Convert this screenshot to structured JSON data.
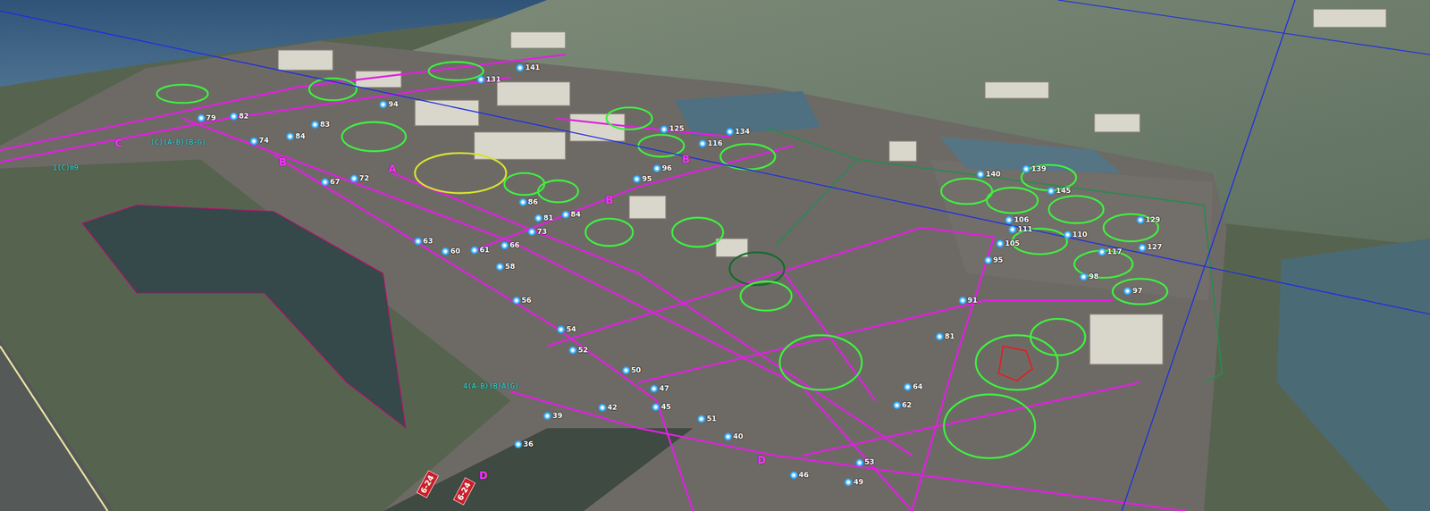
{
  "viewport": {
    "markers": [
      {
        "label": "79"
      },
      {
        "label": "82"
      },
      {
        "label": "74"
      },
      {
        "label": "84"
      },
      {
        "label": "83"
      },
      {
        "label": "94"
      },
      {
        "label": "131"
      },
      {
        "label": "141"
      },
      {
        "label": "125"
      },
      {
        "label": "134"
      },
      {
        "label": "116"
      },
      {
        "label": "96"
      },
      {
        "label": "95"
      },
      {
        "label": "86"
      },
      {
        "label": "84"
      },
      {
        "label": "81"
      },
      {
        "label": "72"
      },
      {
        "label": "67"
      },
      {
        "label": "63"
      },
      {
        "label": "60"
      },
      {
        "label": "61"
      },
      {
        "label": "66"
      },
      {
        "label": "73"
      },
      {
        "label": "58"
      },
      {
        "label": "56"
      },
      {
        "label": "54"
      },
      {
        "label": "52"
      },
      {
        "label": "50"
      },
      {
        "label": "47"
      },
      {
        "label": "45"
      },
      {
        "label": "51"
      },
      {
        "label": "42"
      },
      {
        "label": "39"
      },
      {
        "label": "36"
      },
      {
        "label": "40"
      },
      {
        "label": "46"
      },
      {
        "label": "49"
      },
      {
        "label": "53"
      },
      {
        "label": "64"
      },
      {
        "label": "62"
      },
      {
        "label": "81"
      },
      {
        "label": "91"
      },
      {
        "label": "97"
      },
      {
        "label": "95"
      },
      {
        "label": "98"
      },
      {
        "label": "140"
      },
      {
        "label": "139"
      },
      {
        "label": "145"
      },
      {
        "label": "129"
      },
      {
        "label": "127"
      },
      {
        "label": "117"
      },
      {
        "label": "106"
      },
      {
        "label": "110"
      },
      {
        "label": "111"
      },
      {
        "label": "105"
      }
    ],
    "taxiway_labels": [
      {
        "label": "C"
      },
      {
        "label": "B"
      },
      {
        "label": "A"
      },
      {
        "label": "B"
      },
      {
        "label": "D"
      },
      {
        "label": "B"
      },
      {
        "label": "D"
      }
    ],
    "annotations": [
      {
        "text": "(C)(A-B)(B-G)"
      },
      {
        "text": "1(C)m9"
      },
      {
        "text": "4(A-B)(B)A(G)"
      }
    ],
    "runway_signs": [
      {
        "text": "6-24"
      },
      {
        "text": "6-24"
      }
    ]
  }
}
